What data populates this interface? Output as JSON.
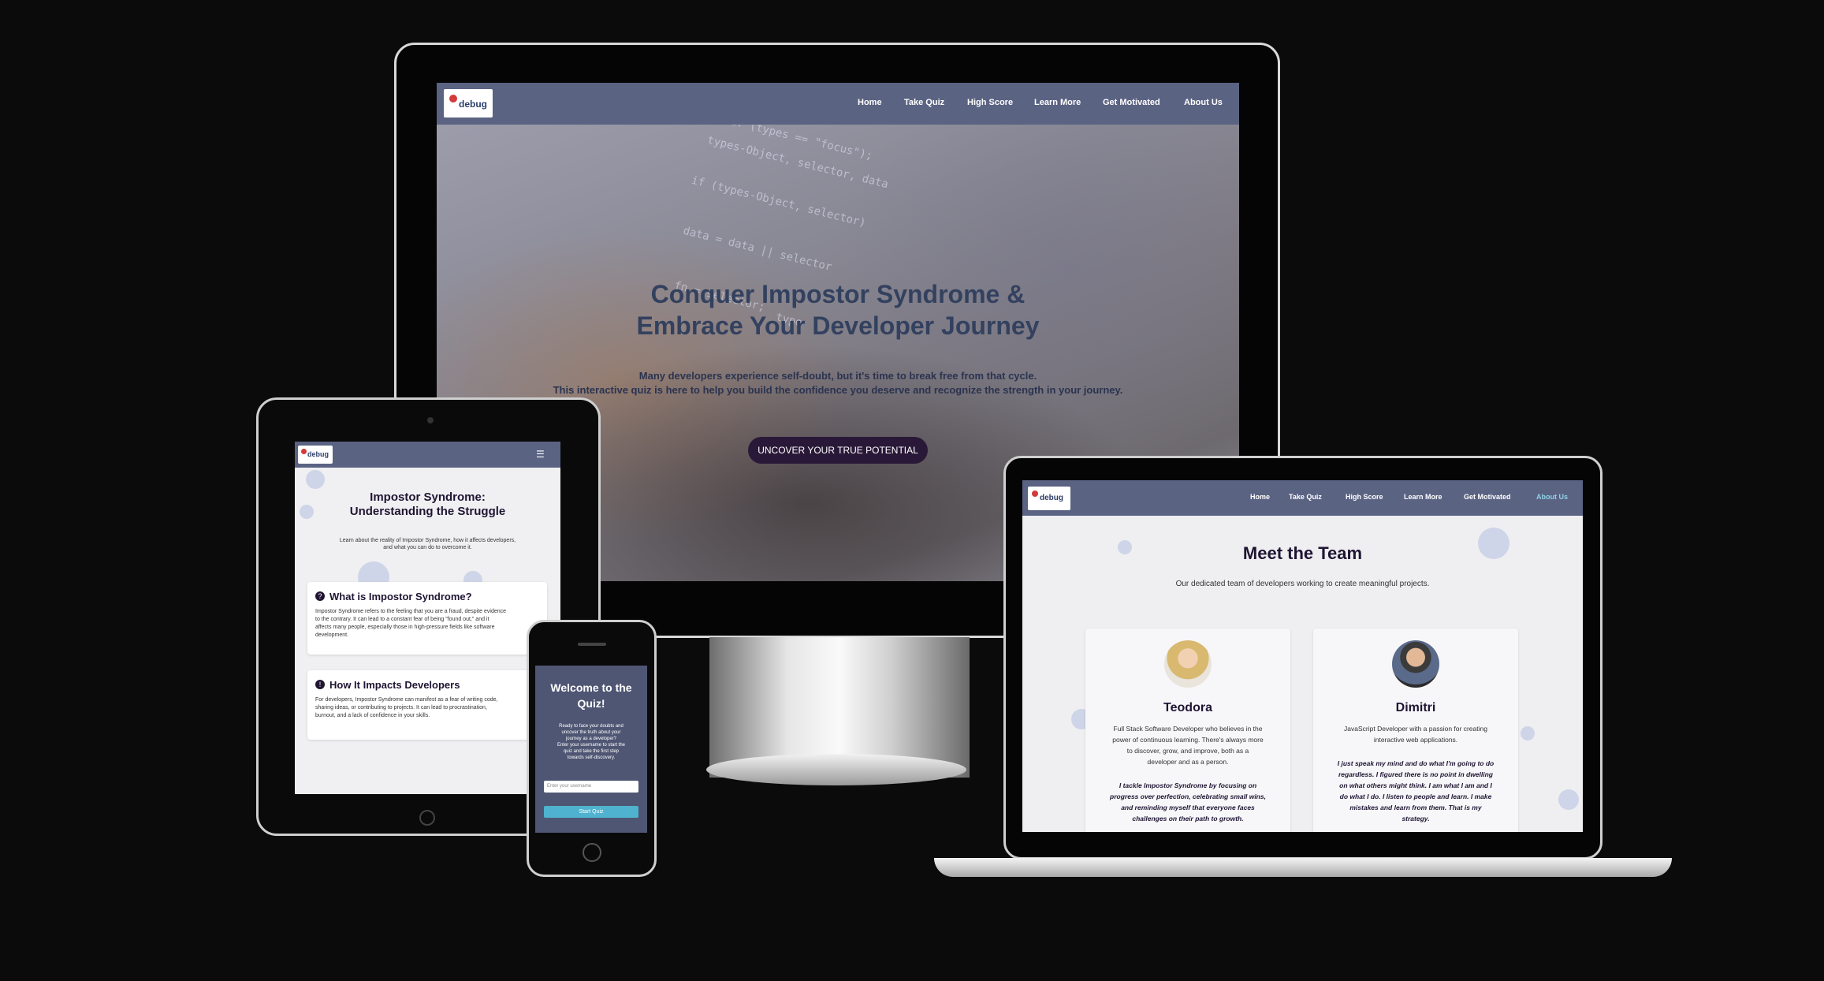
{
  "logo": {
    "text": "debug"
  },
  "desktop": {
    "nav": [
      "Home",
      "Take Quiz",
      "High Score",
      "Learn More",
      "Get Motivated",
      "About Us"
    ],
    "hero": {
      "title_line1": "Conquer Impostor Syndrome &",
      "title_line2": "Embrace Your Developer Journey",
      "subtitle_line1": "Many developers experience self-doubt, but it's time to break free from that cycle.",
      "subtitle_line2": "This interactive quiz is here to help you build the confidence you deserve and recognize the strength in your journey.",
      "cta": "UNCOVER YOUR TRUE POTENTIAL"
    }
  },
  "tablet": {
    "title_line1": "Impostor Syndrome:",
    "title_line2": "Understanding the Struggle",
    "intro_line1": "Learn about the reality of Impostor Syndrome, how it affects developers,",
    "intro_line2": "and what you can do to overcome it.",
    "sections": [
      {
        "heading": "What is Impostor Syndrome?",
        "lines": [
          "Impostor Syndrome refers to the feeling that you are a fraud, despite evidence",
          "to the contrary. It can lead to a constant fear of being \"found out,\" and it",
          "affects many people, especially those in high-pressure fields like software",
          "development."
        ]
      },
      {
        "heading": "How It Impacts Developers",
        "lines": [
          "For developers, Impostor Syndrome can manifest as a fear of writing code,",
          "sharing ideas, or contributing to projects. It can lead to procrastination,",
          "burnout, and a lack of confidence in your skills."
        ]
      }
    ]
  },
  "phone": {
    "title_line1": "Welcome to the",
    "title_line2": "Quiz!",
    "lines": [
      "Ready to face your doubts and",
      "uncover the truth about your",
      "journey as a developer?",
      "Enter your username to start the",
      "quiz and take the first step",
      "towards self-discovery."
    ],
    "input_placeholder": "Enter your username",
    "button": "Start Quiz"
  },
  "laptop": {
    "nav": [
      "Home",
      "Take Quiz",
      "High Score",
      "Learn More",
      "Get Motivated",
      "About Us"
    ],
    "title": "Meet the Team",
    "subtitle": "Our dedicated team of developers working to create meaningful projects.",
    "members": [
      {
        "name": "Teodora",
        "bio": [
          "Full Stack Software Developer who believes in the",
          "power of continuous learning. There's always more",
          "to discover, grow, and improve, both as a",
          "developer and as a person."
        ],
        "quote": [
          "I tackle Impostor Syndrome by focusing on",
          "progress over perfection, celebrating small wins,",
          "and reminding myself that everyone faces",
          "challenges on their path to growth."
        ]
      },
      {
        "name": "Dimitri",
        "bio": [
          "JavaScript Developer with a passion for creating",
          "interactive web applications."
        ],
        "quote": [
          "I just speak my mind and do what I'm going to do",
          "regardless. I figured there is no point in dwelling",
          "on what others might think. I am what I am and I",
          "do what I do. I listen to people and learn. I make",
          "mistakes and learn from them. That is my",
          "strategy."
        ]
      }
    ]
  },
  "colors": {
    "nav": "#5b6383",
    "hero_title": "#33415f",
    "cta": "#2a1838",
    "phone_button": "#4fb2cf",
    "active_link": "#8fd0e6"
  }
}
